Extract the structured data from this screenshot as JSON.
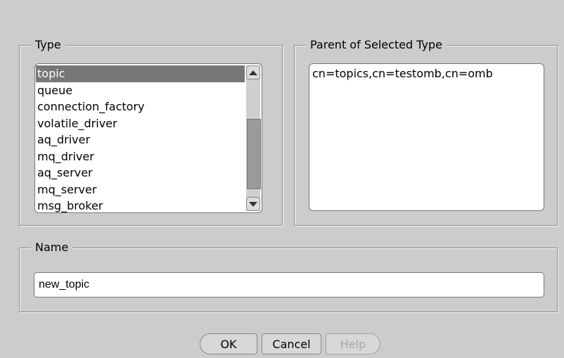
{
  "type_group": {
    "legend": "Type",
    "items": [
      "topic",
      "queue",
      "connection_factory",
      "volatile_driver",
      "aq_driver",
      "mq_driver",
      "aq_server",
      "mq_server",
      "msg_broker"
    ],
    "selected_index": 0
  },
  "parent_group": {
    "legend": "Parent of Selected Type",
    "value": "cn=topics,cn=testomb,cn=omb"
  },
  "name_group": {
    "legend": "Name",
    "value": "new_topic"
  },
  "buttons": {
    "ok": "OK",
    "cancel": "Cancel",
    "help": "Help"
  },
  "colors": {
    "background": "#cccccc",
    "selection": "#777777",
    "disabled_text": "#a8a8a8"
  }
}
